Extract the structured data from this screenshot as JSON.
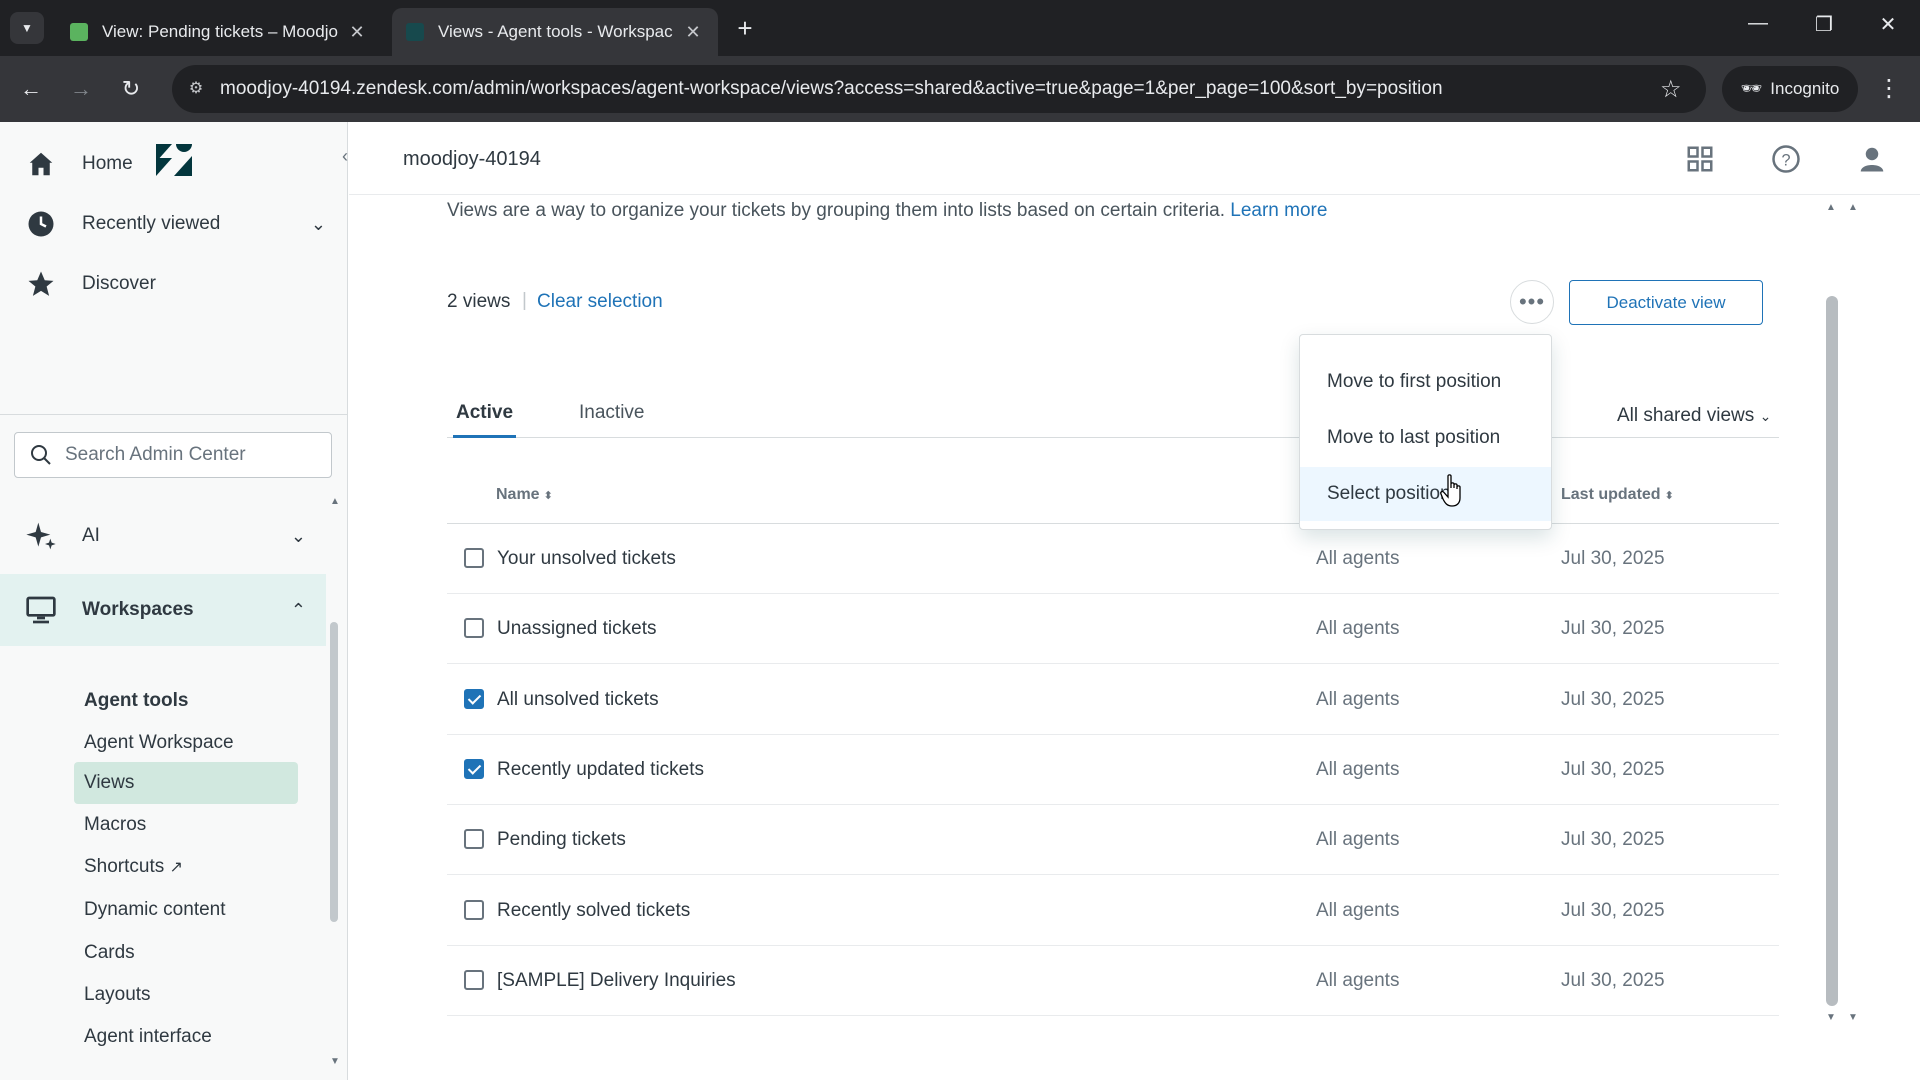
{
  "browser": {
    "tabs": [
      {
        "title": "View: Pending tickets – Moodjo",
        "active": false,
        "favicon_color": "#5bb35f"
      },
      {
        "title": "Views - Agent tools - Workspac",
        "active": true,
        "favicon_color": "#03363d"
      }
    ],
    "close_glyph": "✕",
    "new_tab_glyph": "+",
    "url": "moodjoy-40194.zendesk.com/admin/workspaces/agent-workspace/views?access=shared&active=true&page=1&per_page=100&sort_by=position",
    "incognito_label": "Incognito"
  },
  "sidebar": {
    "nav": [
      {
        "label": "Home",
        "icon": "home-icon"
      },
      {
        "label": "Recently viewed",
        "icon": "clock-icon"
      },
      {
        "label": "Discover",
        "icon": "star-icon"
      }
    ],
    "search_placeholder": "Search Admin Center",
    "ai_label": "AI",
    "workspaces_label": "Workspaces",
    "section_header": "Agent tools",
    "sub_items": [
      "Agent Workspace",
      "Views",
      "Macros",
      "Shortcuts",
      "Dynamic content",
      "Cards",
      "Layouts",
      "Agent interface"
    ],
    "active_sub_item": "Views"
  },
  "header": {
    "subdomain": "moodjoy-40194"
  },
  "main": {
    "intro_text": "Views are a way to organize your tickets by grouping them into lists based on certain criteria.",
    "learn_more": "Learn more",
    "selection_count": "2 views",
    "separator": "|",
    "clear_selection": "Clear selection",
    "more_glyph": "•••",
    "deactivate_button": "Deactivate view",
    "tabs": [
      "Active",
      "Inactive"
    ],
    "filter_label": "All shared views",
    "columns": {
      "name": "Name",
      "updated": "Last updated"
    },
    "rows": [
      {
        "name": "Your unsolved tickets",
        "access": "All agents",
        "updated": "Jul 30, 2025",
        "checked": false
      },
      {
        "name": "Unassigned tickets",
        "access": "All agents",
        "updated": "Jul 30, 2025",
        "checked": false
      },
      {
        "name": "All unsolved tickets",
        "access": "All agents",
        "updated": "Jul 30, 2025",
        "checked": true
      },
      {
        "name": "Recently updated tickets",
        "access": "All agents",
        "updated": "Jul 30, 2025",
        "checked": true
      },
      {
        "name": "Pending tickets",
        "access": "All agents",
        "updated": "Jul 30, 2025",
        "checked": false
      },
      {
        "name": "Recently solved tickets",
        "access": "All agents",
        "updated": "Jul 30, 2025",
        "checked": false
      },
      {
        "name": "[SAMPLE] Delivery Inquiries",
        "access": "All agents",
        "updated": "Jul 30, 2025",
        "checked": false
      }
    ]
  },
  "dropdown": {
    "items": [
      "Move to first position",
      "Move to last position",
      "Select position"
    ],
    "hovered_index": 2
  },
  "colors": {
    "accent": "#1f73b7",
    "sidebar_active": "#e3f2f0",
    "brand": "#03363d"
  }
}
